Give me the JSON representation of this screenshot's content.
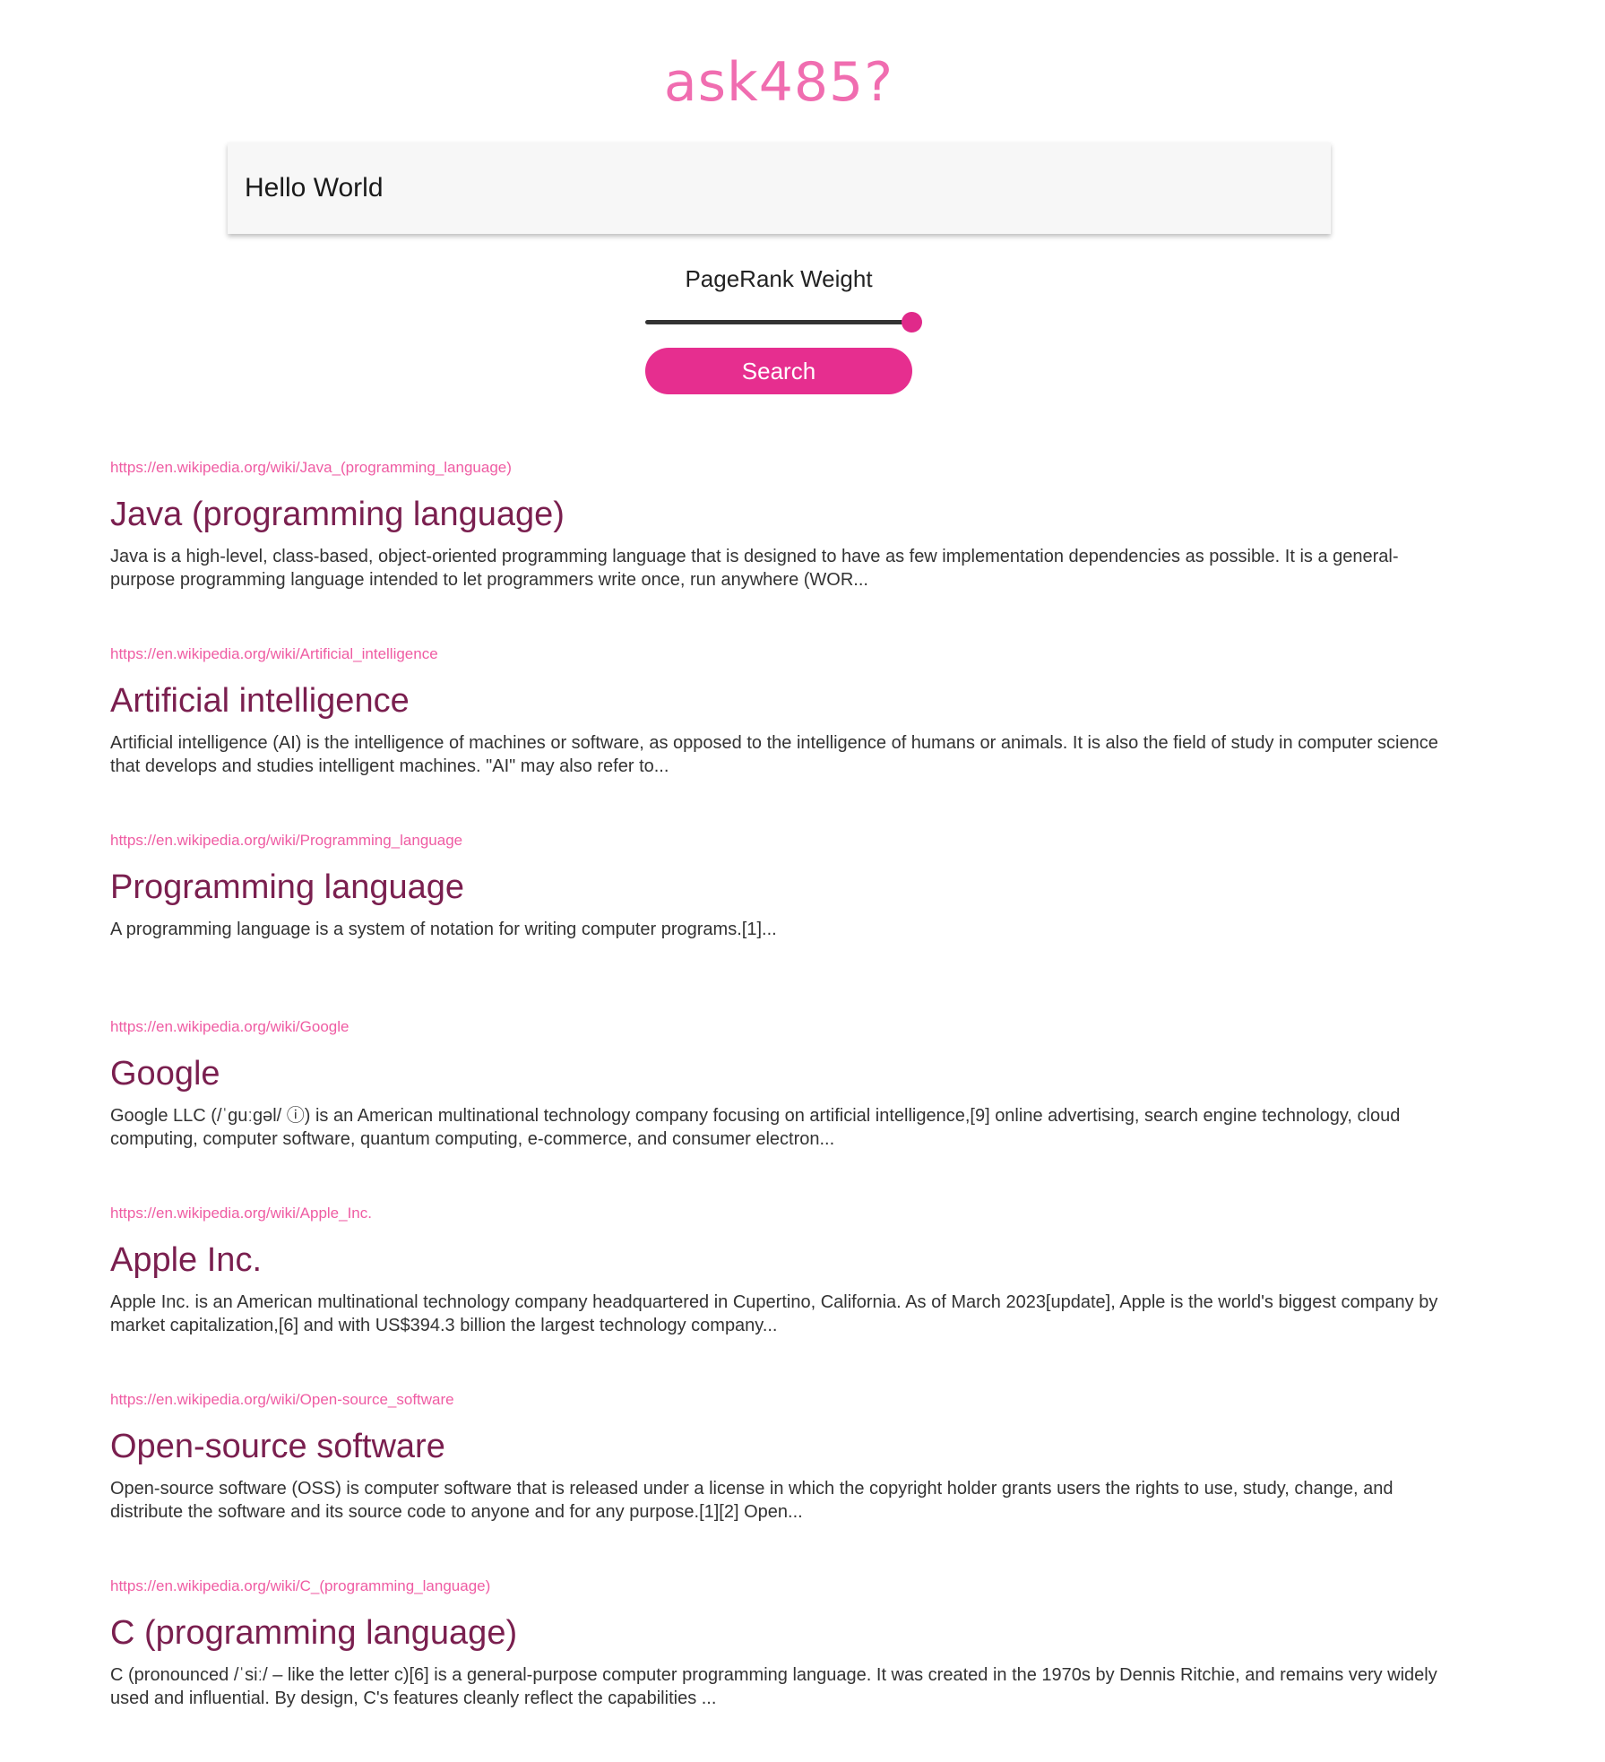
{
  "brand": {
    "title": "ask485?"
  },
  "search": {
    "query": "Hello World",
    "button_label": "Search"
  },
  "pagerank": {
    "label": "PageRank Weight",
    "value": 1.0
  },
  "colors": {
    "brand": "#f06db0",
    "accent": "#e62e8f",
    "title": "#7a1f4f",
    "url": "#ef5ca3"
  },
  "results": [
    {
      "url": "https://en.wikipedia.org/wiki/Java_(programming_language)",
      "title": "Java (programming language)",
      "snippet": "Java is a high-level, class-based, object-oriented programming language that is designed to have as few implementation dependencies as possible. It is a general-purpose programming language intended to let programmers write once, run anywhere (WOR..."
    },
    {
      "url": "https://en.wikipedia.org/wiki/Artificial_intelligence",
      "title": "Artificial intelligence",
      "snippet": "Artificial intelligence (AI) is the intelligence of machines or software, as opposed to the intelligence of humans or animals. It is also the field of study in computer science that develops and studies intelligent machines. \"AI\" may also refer to..."
    },
    {
      "url": "https://en.wikipedia.org/wiki/Programming_language",
      "title": "Programming language",
      "snippet": "A programming language is a system of notation for writing computer programs.[1]..."
    },
    {
      "url": "https://en.wikipedia.org/wiki/Google",
      "title": "Google",
      "snippet": "Google LLC (/ˈɡuːɡəl/ ⓘ) is an American multinational technology company focusing on artificial intelligence,[9] online advertising, search engine technology, cloud computing, computer software, quantum computing, e-commerce, and consumer electron..."
    },
    {
      "url": "https://en.wikipedia.org/wiki/Apple_Inc.",
      "title": "Apple Inc.",
      "snippet": "Apple Inc. is an American multinational technology company headquartered in Cupertino, California. As of March 2023[update], Apple is the world's biggest company by market capitalization,[6] and with US$394.3 billion the largest technology company..."
    },
    {
      "url": "https://en.wikipedia.org/wiki/Open-source_software",
      "title": "Open-source software",
      "snippet": "Open-source software (OSS) is computer software that is released under a license in which the copyright holder grants users the rights to use, study, change, and distribute the software and its source code to anyone and for any purpose.[1][2] Open..."
    },
    {
      "url": "https://en.wikipedia.org/wiki/C_(programming_language)",
      "title": "C (programming language)",
      "snippet": "C (pronounced /ˈsiː/ – like the letter c)[6] is a general-purpose computer programming language. It was created in the 1970s by Dennis Ritchie, and remains very widely used and influential. By design, C's features cleanly reflect the capabilities ..."
    }
  ]
}
